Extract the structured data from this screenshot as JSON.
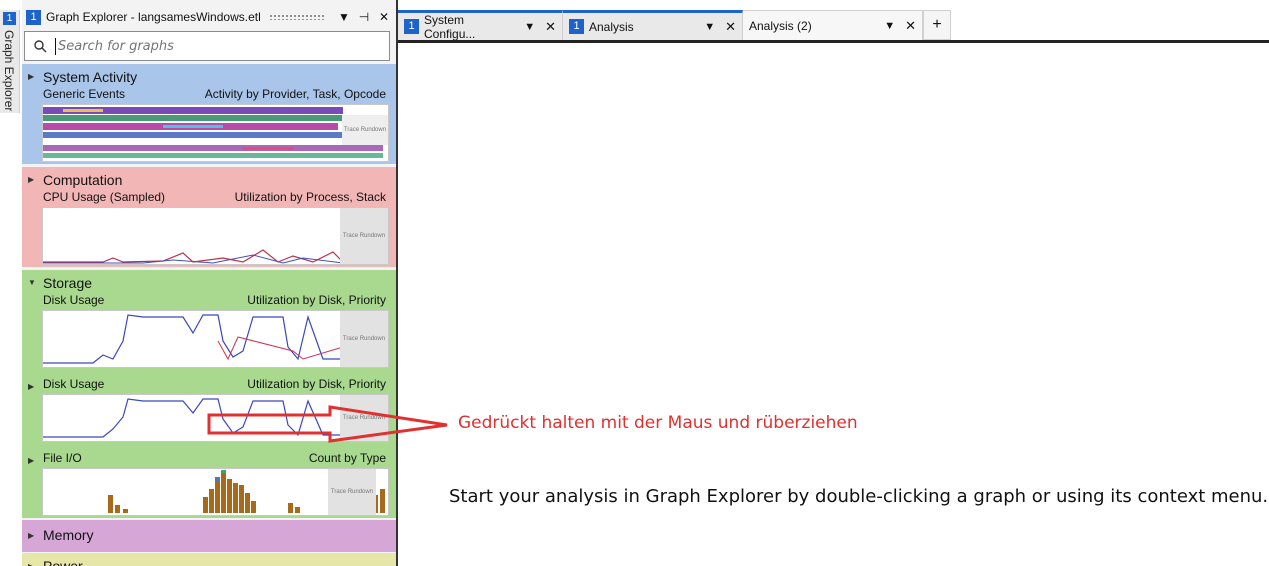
{
  "side_tab": {
    "number": "1",
    "label": "Graph Explorer"
  },
  "panel": {
    "badge": "1",
    "title": "Graph Explorer - langsamesWindows.etl",
    "search_placeholder": "Search for graphs",
    "categories": [
      {
        "title": "System Activity",
        "sub_left": "Generic Events",
        "sub_right": "Activity by Provider, Task, Opcode",
        "color": "#a9c6ea"
      },
      {
        "title": "Computation",
        "sub_left": "CPU Usage (Sampled)",
        "sub_right": "Utilization by Process, Stack",
        "color": "#f3b6b6"
      },
      {
        "title": "Storage",
        "sub_left": "Disk Usage",
        "sub_right": "Utilization by Disk, Priority",
        "color": "#a8d98f"
      },
      {
        "title": "Memory",
        "color": "#d6a7d6"
      },
      {
        "title": "Power",
        "color": "#e6e6a8"
      }
    ],
    "storage_graphs": [
      {
        "left": "Disk Usage",
        "right": "Utilization by Disk, Priority"
      },
      {
        "left": "File I/O",
        "right": "Count by Type"
      }
    ],
    "rundown_label": "Trace Rundown"
  },
  "tabs": [
    {
      "badge": "1",
      "label": "System Configu...",
      "active": false
    },
    {
      "badge": "1",
      "label": "Analysis",
      "active": false
    },
    {
      "badge": "",
      "label": "Analysis (2)",
      "active": true
    }
  ],
  "annotation": "Gedrückt halten mit der Maus und rüberziehen",
  "hint": "Start your analysis in Graph Explorer by double-clicking a graph or using its context menu."
}
